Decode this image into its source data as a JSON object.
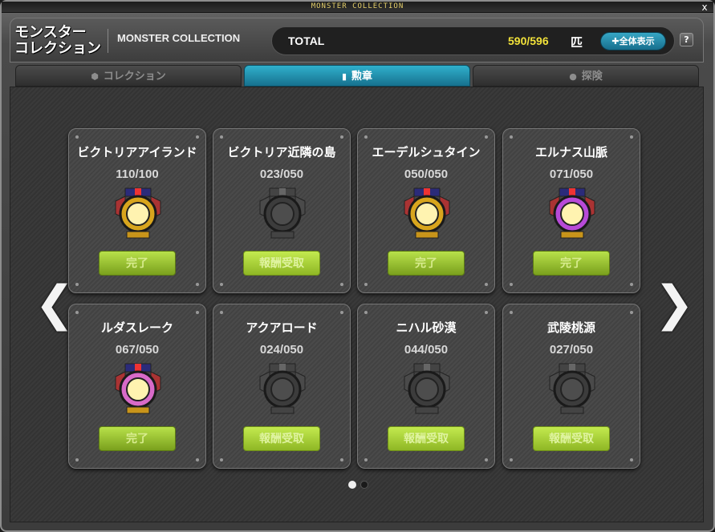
{
  "window": {
    "title": "MONSTER COLLECTION",
    "close_label": "x"
  },
  "header": {
    "logo_line1": "モンスター",
    "logo_line2": "コレクション",
    "subtitle": "MONSTER COLLECTION",
    "total_label": "TOTAL",
    "total_count": "590/596",
    "total_unit": "匹",
    "show_all_label": "全体表示",
    "help_label": "?"
  },
  "tabs": [
    {
      "label": "コレクション",
      "icon": "cube-icon",
      "active": false
    },
    {
      "label": "勲章",
      "icon": "bookmark-icon",
      "active": true
    },
    {
      "label": "探険",
      "icon": "map-pin-icon",
      "active": false
    }
  ],
  "nav": {
    "prev_label": "❮",
    "next_label": "❯"
  },
  "cards": [
    {
      "name": "ビクトリアアイランド",
      "progress": "110/100",
      "button": "完了",
      "state": "complete",
      "medal": "victoria-medal-icon",
      "color": "#d8a51d"
    },
    {
      "name": "ビクトリア近隣の島",
      "progress": "023/050",
      "button": "報酬受取",
      "state": "reward",
      "medal": "anchor-medal-icon",
      "color": "#555555"
    },
    {
      "name": "エーデルシュタイン",
      "progress": "050/050",
      "button": "完了",
      "state": "complete",
      "medal": "edelstein-medal-icon",
      "color": "#d8a51d"
    },
    {
      "name": "エルナス山脈",
      "progress": "071/050",
      "button": "完了",
      "state": "complete",
      "medal": "snowflake-medal-icon",
      "color": "#b84ad8"
    },
    {
      "name": "ルダスレーク",
      "progress": "067/050",
      "button": "完了",
      "state": "complete",
      "medal": "ludus-medal-icon",
      "color": "#d86ac8"
    },
    {
      "name": "アクアロード",
      "progress": "024/050",
      "button": "報酬受取",
      "state": "reward",
      "medal": "aqua-medal-icon",
      "color": "#555555"
    },
    {
      "name": "ニハル砂漠",
      "progress": "044/050",
      "button": "報酬受取",
      "state": "reward",
      "medal": "desert-medal-icon",
      "color": "#555555"
    },
    {
      "name": "武陵桃源",
      "progress": "027/050",
      "button": "報酬受取",
      "state": "reward",
      "medal": "mulung-medal-icon",
      "color": "#555555"
    }
  ],
  "pagination": {
    "current": 1,
    "total": 2
  }
}
